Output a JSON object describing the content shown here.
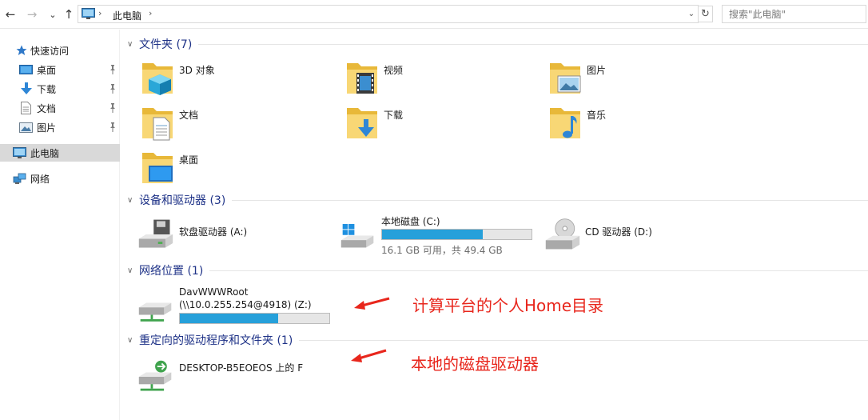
{
  "address": {
    "crumb": "此电脑",
    "refresh_glyph": "↻"
  },
  "search": {
    "placeholder": "搜索\"此电脑\""
  },
  "nav": {
    "back_glyph": "←",
    "forward_glyph": "→",
    "recent_glyph": "⌄",
    "up_glyph": "↑",
    "quick_access": "快速访问",
    "quick_items": [
      {
        "label": "桌面",
        "icon": "desktop-icon"
      },
      {
        "label": "下载",
        "icon": "download-icon"
      },
      {
        "label": "文档",
        "icon": "documents-icon"
      },
      {
        "label": "图片",
        "icon": "pictures-icon"
      }
    ],
    "this_pc": "此电脑",
    "network": "网络"
  },
  "groups": {
    "folders": "文件夹 (7)",
    "devices": "设备和驱动器 (3)",
    "network_locations": "网络位置 (1)",
    "redirected": "重定向的驱动程序和文件夹 (1)"
  },
  "folders": [
    {
      "label": "3D 对象",
      "icon": "3d-objects-icon"
    },
    {
      "label": "视频",
      "icon": "videos-icon"
    },
    {
      "label": "图片",
      "icon": "pictures-icon"
    },
    {
      "label": "文档",
      "icon": "documents-icon"
    },
    {
      "label": "下载",
      "icon": "downloads-icon"
    },
    {
      "label": "音乐",
      "icon": "music-icon"
    },
    {
      "label": "桌面",
      "icon": "desktop-icon"
    }
  ],
  "drives": {
    "floppy": {
      "label": "软盘驱动器 (A:)"
    },
    "local": {
      "label": "本地磁盘 (C:)",
      "sub": "16.1 GB 可用，共 49.4 GB",
      "used_fraction": 0.674
    },
    "cd": {
      "label": "CD 驱动器 (D:)"
    }
  },
  "network_drive": {
    "name": "DavWWWRoot",
    "path": "(\\\\10.0.255.254@4918) (Z:)",
    "used_fraction": 0.66
  },
  "redirected_drive": {
    "label": "DESKTOP-B5EOEOS 上的 F"
  },
  "annotations": {
    "home": "计算平台的个人Home目录",
    "local": "本地的磁盘驱动器",
    "color": "#e8261c"
  },
  "colors": {
    "accent": "#26a0da",
    "group_title": "#1e3287",
    "selected_bg": "#d9d9d9"
  }
}
